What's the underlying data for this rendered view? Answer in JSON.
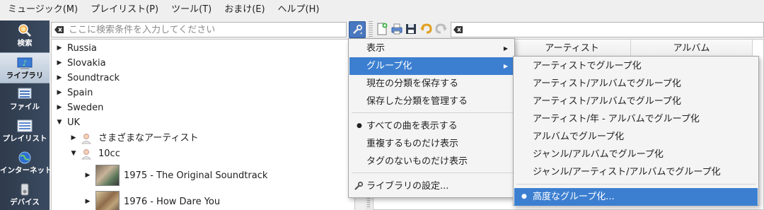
{
  "menubar": [
    "ミュージック(M)",
    "プレイリスト(P)",
    "ツール(T)",
    "おまけ(E)",
    "ヘルプ(H)"
  ],
  "sidebar": {
    "tabs": [
      {
        "label": "検索",
        "icon": "magnifier-icon"
      },
      {
        "label": "ライブラリ",
        "icon": "library-icon",
        "active": true
      },
      {
        "label": "ファイル",
        "icon": "files-icon"
      },
      {
        "label": "プレイリスト",
        "icon": "playlist-icon"
      },
      {
        "label": "インターネット",
        "icon": "internet-icon"
      },
      {
        "label": "デバイス",
        "icon": "device-icon"
      }
    ]
  },
  "search": {
    "placeholder": "ここに検索条件を入力してください"
  },
  "tree": {
    "items": [
      {
        "label": "Russia",
        "expanded": false
      },
      {
        "label": "Slovakia",
        "expanded": false
      },
      {
        "label": "Soundtrack",
        "expanded": false
      },
      {
        "label": "Spain",
        "expanded": false
      },
      {
        "label": "Sweden",
        "expanded": false
      },
      {
        "label": "UK",
        "expanded": true
      },
      {
        "label": "さまざまなアーティスト",
        "expanded": false
      },
      {
        "label": "10cc",
        "expanded": true
      },
      {
        "label": "1975 - The Original Soundtrack",
        "expanded": false
      },
      {
        "label": "1976 - How Dare You",
        "expanded": false
      }
    ]
  },
  "playlist": {
    "columns": [
      "アーティスト",
      "アルバム"
    ]
  },
  "context_menu": {
    "items": [
      {
        "label": "表示",
        "submenu": true
      },
      {
        "label": "グループ化",
        "submenu": true,
        "highlighted": true
      },
      {
        "label": "現在の分類を保存する"
      },
      {
        "label": "保存した分類を管理する"
      },
      {
        "label": "すべての曲を表示する",
        "checked": true
      },
      {
        "label": "重複するものだけ表示"
      },
      {
        "label": "タグのないものだけ表示"
      },
      {
        "label": "ライブラリの設定..."
      }
    ]
  },
  "submenu": {
    "items": [
      {
        "label": "アーティストでグループ化"
      },
      {
        "label": "アーティスト/アルバムでグループ化"
      },
      {
        "label": "アーティスト/アルバムでグループ化"
      },
      {
        "label": "アーティスト/年 - アルバムでグループ化"
      },
      {
        "label": "アルバムでグループ化"
      },
      {
        "label": "ジャンル/アルバムでグループ化"
      },
      {
        "label": "ジャンル/アーティスト/アルバムでグループ化"
      },
      {
        "label": "高度なグループ化...",
        "checked": true,
        "highlighted": true
      }
    ]
  },
  "colors": {
    "highlight": "#3c7fd1",
    "sidebar_bg": "#33425a",
    "menu_bg": "#f4f4f4"
  }
}
